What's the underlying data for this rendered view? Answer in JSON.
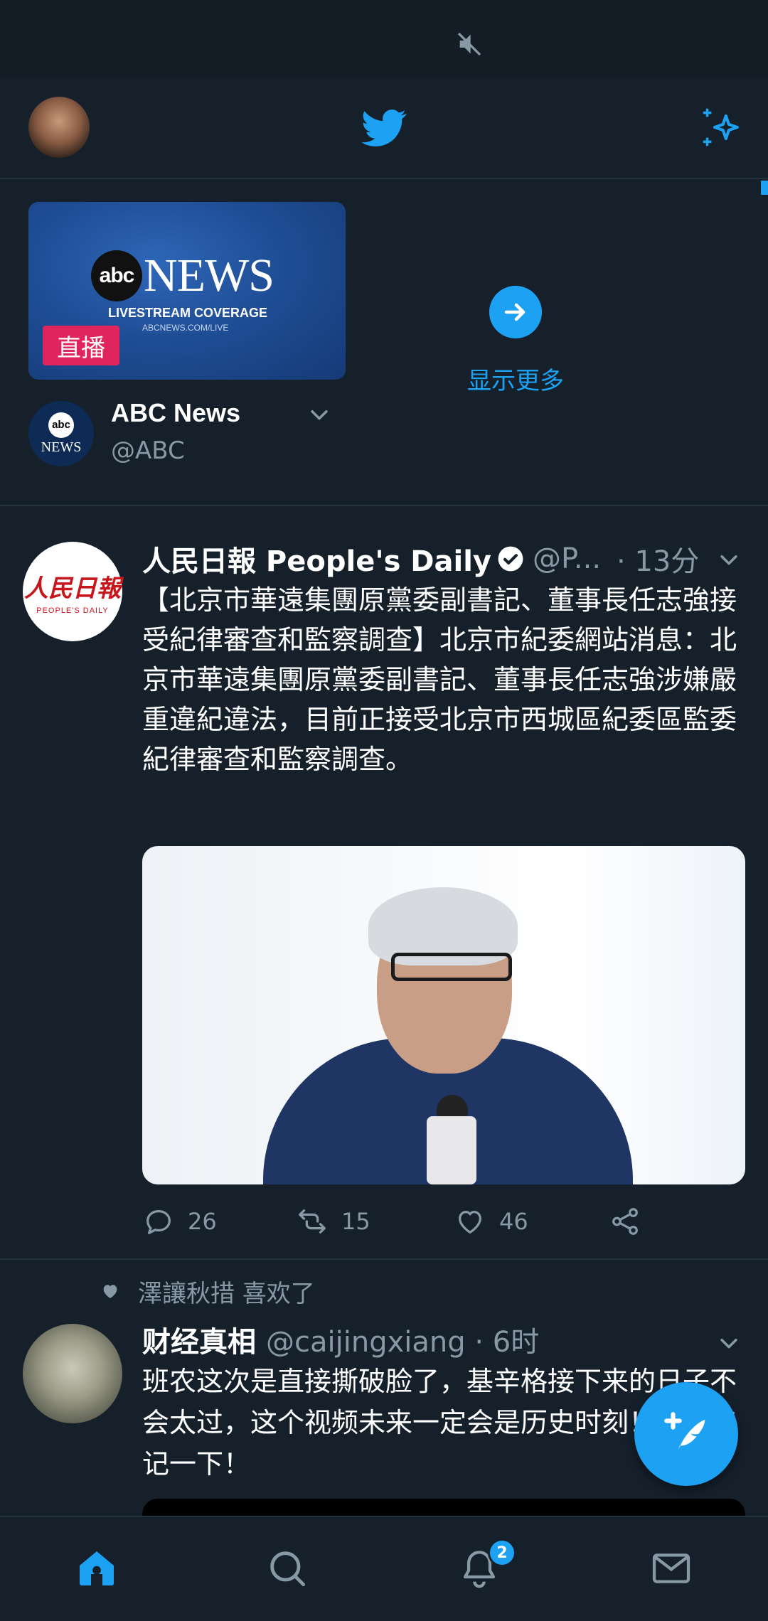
{
  "header": {
    "profile_avatar": "user-avatar",
    "logo_icon": "twitter-bird-icon",
    "top_tweets_icon": "sparkle-icon"
  },
  "live_card": {
    "thumbnail_brand": "NEWS",
    "thumbnail_brand_prefix": "abc",
    "thumbnail_caption": "LIVESTREAM COVERAGE",
    "thumbnail_url": "ABCNEWS.COM/LIVE",
    "live_badge": "直播",
    "show_more_label": "显示更多",
    "account_name": "ABC News",
    "account_handle": "@ABC",
    "avatar_top": "abc",
    "avatar_bottom": "NEWS"
  },
  "tweets": [
    {
      "author_name": "人民日報  People's Daily",
      "author_handle": "@P...",
      "time": "· 13分",
      "verified": true,
      "avatar_cn": "人民日報",
      "avatar_en": "PEOPLE'S DAILY",
      "text": "【北京市華遠集團原黨委副書記、董事長任志強接受紀律審查和監察調查】北京市紀委網站消息：北京市華遠集團原黨委副書記、董事長任志強涉嫌嚴重違紀違法，目前正接受北京市西城區紀委區監委紀律審查和監察調查。",
      "replies": "26",
      "retweets": "15",
      "likes": "46"
    },
    {
      "social_context": "澤讓秋措 喜欢了",
      "author_name": "财经真相",
      "author_handle": "@caijingxiang · 6时",
      "text": "班农这次是直接撕破脸了，基辛格接下来的日子不会太过，这个视频未来一定会是历史时刻！提前铭记一下！"
    }
  ],
  "bottom_nav": {
    "items": [
      "home-icon",
      "search-icon",
      "notifications-icon",
      "messages-icon"
    ],
    "notification_count": "2"
  },
  "colors": {
    "background": "#15202b",
    "accent": "#1da1f2",
    "muted_text": "#8899a6",
    "live_red": "#e0245e"
  }
}
